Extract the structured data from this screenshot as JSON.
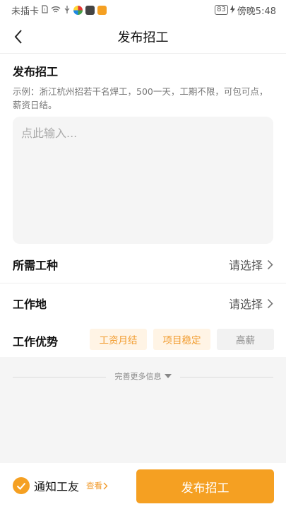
{
  "status_bar": {
    "carrier": "未插卡",
    "battery": "83",
    "time": "傍晚5:48"
  },
  "header": {
    "title": "发布招工"
  },
  "form": {
    "section_title": "发布招工",
    "hint": "示例：浙江杭州招若干名焊工，500一天，工期不限，可包可点，薪资日结。",
    "input_placeholder": "点此输入...",
    "fields": [
      {
        "label": "所需工种",
        "value": "请选择"
      },
      {
        "label": "工作地",
        "value": "请选择"
      }
    ],
    "advantage_label": "工作优势",
    "advantage_tags": [
      {
        "label": "工资月结",
        "selected": true
      },
      {
        "label": "项目稳定",
        "selected": true
      },
      {
        "label": "高薪",
        "selected": false
      }
    ],
    "more_info": "完善更多信息"
  },
  "footer": {
    "notify_label": "通知工友",
    "notify_checked": true,
    "view_link": "查看",
    "publish_button": "发布招工"
  },
  "colors": {
    "accent": "#f5a022",
    "tag_bg": "#fff4e5",
    "tag_text": "#f19a2b"
  }
}
